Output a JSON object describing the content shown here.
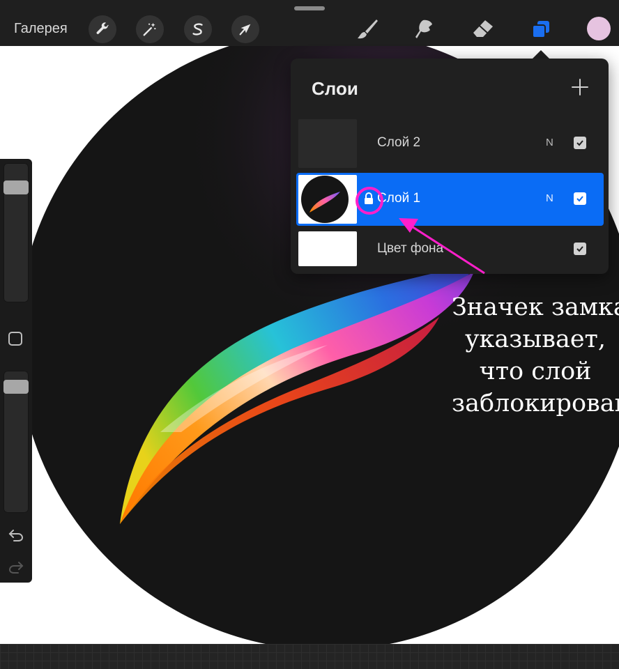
{
  "toolbar": {
    "gallery_label": "Галерея",
    "actions_icon": "wrench-icon",
    "adjustments_icon": "magic-wand-icon",
    "selection_icon": "selection-s-icon",
    "transform_icon": "arrow-cursor-icon",
    "brush_icon": "brush-icon",
    "smudge_icon": "smudge-icon",
    "eraser_icon": "eraser-icon",
    "layers_icon": "layers-icon",
    "active_color": "#e6c3e0",
    "accent": "#1a6ef0"
  },
  "sidebar": {
    "brush_size_level": 0.12,
    "opacity_level": 0.05,
    "undo_icon": "undo-icon",
    "redo_icon": "redo-icon"
  },
  "layers_panel": {
    "title": "Слои",
    "add_icon": "plus-icon",
    "layers": [
      {
        "name": "Слой 2",
        "blend": "N",
        "visible": true,
        "active": false,
        "locked": false
      },
      {
        "name": "Слой 1",
        "blend": "N",
        "visible": true,
        "active": true,
        "locked": true
      },
      {
        "name": "Цвет фона",
        "blend": "",
        "visible": true,
        "active": false,
        "locked": false
      }
    ],
    "active_color": "#0a6cf5"
  },
  "annotation": {
    "lines": [
      "Значек замка",
      "указывает,",
      "что слой",
      "заблокирован"
    ],
    "color": "#ff1fcb"
  }
}
